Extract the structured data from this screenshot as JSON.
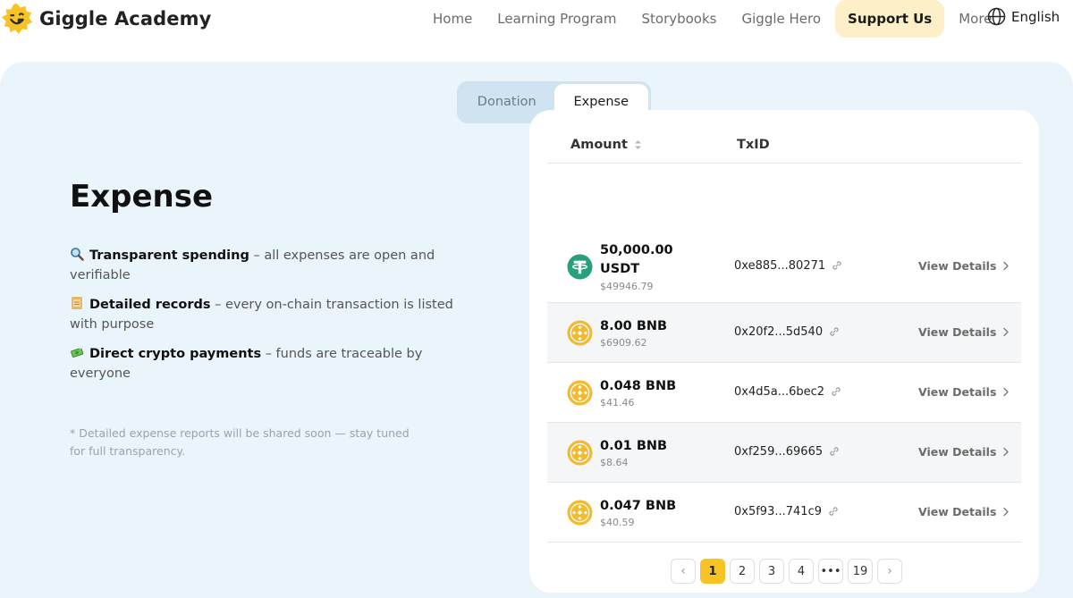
{
  "header": {
    "brand": "Giggle Academy",
    "nav": [
      "Home",
      "Learning Program",
      "Storybooks",
      "Giggle Hero",
      "Support Us",
      "More"
    ],
    "active_nav": "Support Us",
    "language": "English"
  },
  "tabs": {
    "donation": "Donation",
    "expense": "Expense",
    "active": "Expense"
  },
  "intro": {
    "title": "Expense",
    "points": [
      {
        "emoji": "magnifying-glass",
        "bold": "Transparent spending",
        "text": " – all expenses are open and verifiable"
      },
      {
        "emoji": "scroll",
        "bold": "Detailed records",
        "text": " – every on-chain transaction is listed with purpose"
      },
      {
        "emoji": "money-with-wings",
        "bold": "Direct crypto payments",
        "text": " – funds are traceable by everyone"
      }
    ],
    "note": "* Detailed expense reports will be shared soon — stay tuned for full transparency."
  },
  "table": {
    "col_amount": "Amount",
    "col_txid": "TxID",
    "view_details_label": "View Details",
    "rows": [
      {
        "coin": "usdt",
        "amount_line1": "50,000.00",
        "amount_line2": "USDT",
        "usd": "$49946.79",
        "txid": "0xe885...80271"
      },
      {
        "coin": "bnb",
        "amount_line1": "8.00 BNB",
        "amount_line2": "",
        "usd": "$6909.62",
        "txid": "0x20f2...5d540"
      },
      {
        "coin": "bnb",
        "amount_line1": "0.048 BNB",
        "amount_line2": "",
        "usd": "$41.46",
        "txid": "0x4d5a...6bec2"
      },
      {
        "coin": "bnb",
        "amount_line1": "0.01 BNB",
        "amount_line2": "",
        "usd": "$8.64",
        "txid": "0xf259...69665"
      },
      {
        "coin": "bnb",
        "amount_line1": "0.047 BNB",
        "amount_line2": "",
        "usd": "$40.59",
        "txid": "0x5f93...741c9"
      }
    ]
  },
  "pagination": {
    "prev": "‹",
    "pages": [
      "1",
      "2",
      "3",
      "4",
      "•••",
      "19"
    ],
    "current": "1",
    "next": "›"
  },
  "colors": {
    "accent": "#f7c325",
    "tether": "#26a17b",
    "bnb": "#f3ba2f",
    "active_nav_bg": "#fdf0c8",
    "panel_bg": "#e9f4fb"
  }
}
